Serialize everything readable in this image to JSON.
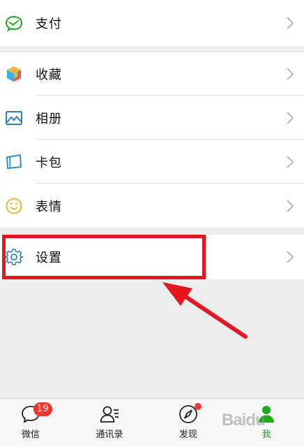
{
  "menu": {
    "pay": {
      "label": "支付",
      "icon": "wallet-check-icon"
    },
    "favorites": {
      "label": "收藏",
      "icon": "cube-icon"
    },
    "album": {
      "label": "相册",
      "icon": "picture-icon"
    },
    "cards": {
      "label": "卡包",
      "icon": "card-icon"
    },
    "stickers": {
      "label": "表情",
      "icon": "smiley-icon"
    },
    "settings": {
      "label": "设置",
      "icon": "gear-icon"
    }
  },
  "tabbar": {
    "tabs": [
      {
        "label": "微信",
        "icon": "chat-bubble-icon",
        "badge": "19"
      },
      {
        "label": "通讯录",
        "icon": "contacts-icon"
      },
      {
        "label": "发现",
        "icon": "compass-icon"
      },
      {
        "label": "我",
        "icon": "person-icon",
        "active": true
      }
    ]
  },
  "watermark": "Baidu",
  "colors": {
    "accent": "#1aad19",
    "annotation": "#e2161c",
    "badge": "#f43530",
    "background": "#ededed"
  }
}
